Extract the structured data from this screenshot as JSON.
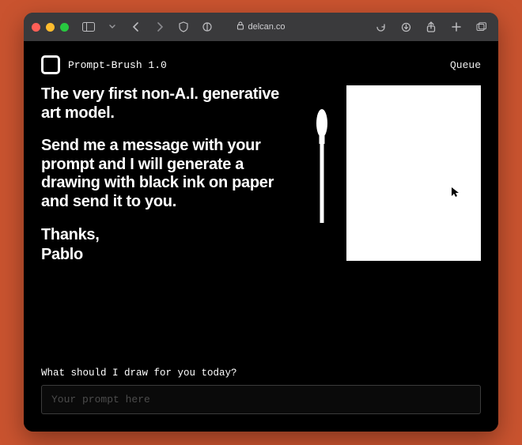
{
  "browser": {
    "address_host": "delcan.co"
  },
  "app": {
    "title": "Prompt-Brush 1.0",
    "nav_queue": "Queue"
  },
  "intro": {
    "para1": "The very first non-A.I. generative art model.",
    "para2": "Send me a message with your prompt and I will generate a drawing with black ink on paper and send it to you.",
    "sign1": "Thanks,",
    "sign2": "Pablo"
  },
  "prompt": {
    "label": "What should I draw for you today?",
    "placeholder": "Your prompt here",
    "value": ""
  }
}
